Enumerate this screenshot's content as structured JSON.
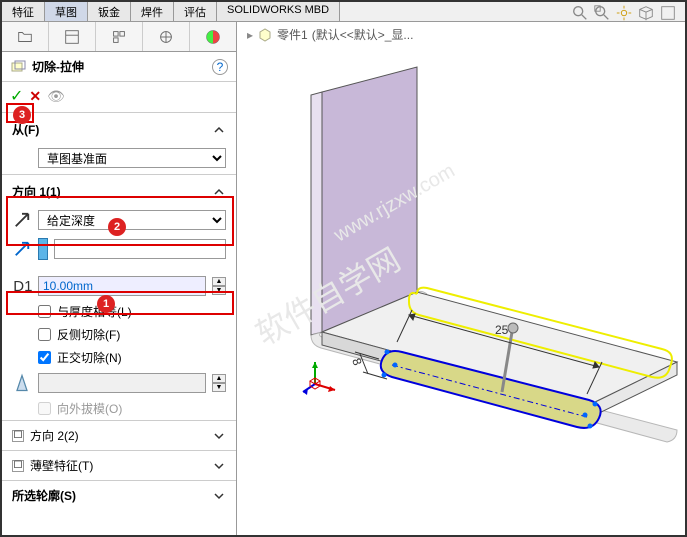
{
  "tabs": {
    "t0": "特征",
    "t1": "草图",
    "t2": "钣金",
    "t3": "焊件",
    "t4": "评估",
    "t5": "SOLIDWORKS MBD"
  },
  "breadcrumb": {
    "part": "零件1",
    "config": "(默认<<默认>_显..."
  },
  "feature": {
    "title": "切除-拉伸",
    "help": "?"
  },
  "actions": {
    "ok": "✓",
    "cancel": "✕",
    "eye": "👁"
  },
  "from": {
    "label": "从(F)",
    "plane": "草图基准面"
  },
  "dir1": {
    "label": "方向 1(1)",
    "end_condition": "给定深度",
    "depth": "10.00mm",
    "link_thickness": "与厚度相等(L)",
    "flip_side": "反侧切除(F)",
    "normal_cut": "正交切除(N)",
    "draft_outward": "向外拔模(O)"
  },
  "dir2": {
    "label": "方向 2(2)"
  },
  "thin": {
    "label": "薄壁特征(T)"
  },
  "contours": {
    "label": "所选轮廓(S)"
  },
  "markers": {
    "m1": "1",
    "m2": "2",
    "m3": "3"
  },
  "dims": {
    "d1": "25",
    "d2": "8"
  }
}
